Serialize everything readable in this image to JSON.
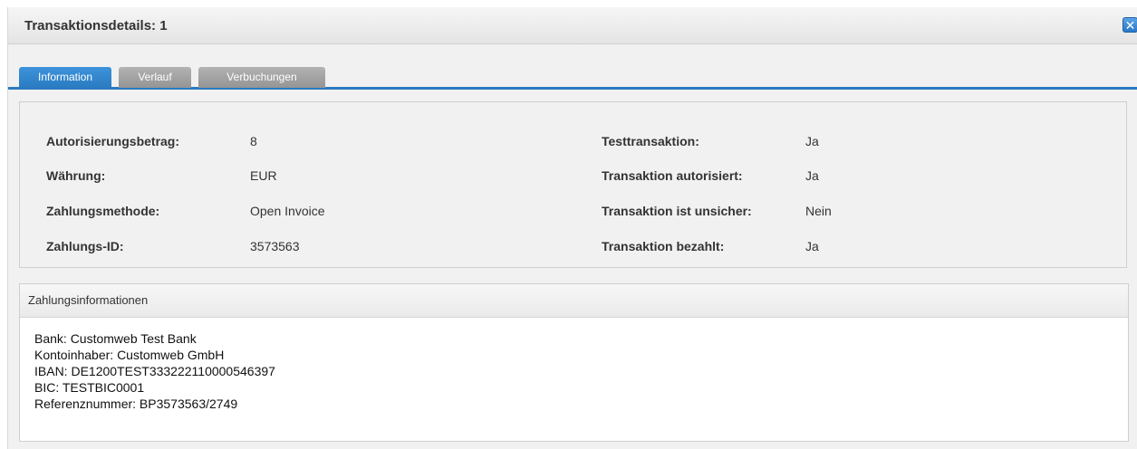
{
  "window": {
    "title": "Transaktionsdetails: 1",
    "close_symbol": "✕",
    "close_icon": "close-icon"
  },
  "tabs": [
    {
      "label": "Information",
      "active": true
    },
    {
      "label": "Verlauf",
      "active": false
    },
    {
      "label": "Verbuchungen",
      "active": false
    }
  ],
  "details": {
    "left": [
      {
        "label": "Autorisierungsbetrag:",
        "value": "8"
      },
      {
        "label": "Währung:",
        "value": "EUR"
      },
      {
        "label": "Zahlungsmethode:",
        "value": "Open Invoice"
      },
      {
        "label": "Zahlungs-ID:",
        "value": "3573563"
      }
    ],
    "right": [
      {
        "label": "Testtransaktion:",
        "value": "Ja"
      },
      {
        "label": "Transaktion autorisiert:",
        "value": "Ja"
      },
      {
        "label": "Transaktion ist unsicher:",
        "value": "Nein"
      },
      {
        "label": "Transaktion bezahlt:",
        "value": "Ja"
      }
    ]
  },
  "payment_info": {
    "header": "Zahlungsinformationen",
    "lines": [
      "Bank: Customweb Test Bank",
      "Kontoinhaber: Customweb GmbH",
      "IBAN: DE1200TEST333222110000546397",
      "BIC: TESTBIC0001",
      "Referenznummer: BP3573563/2749"
    ]
  },
  "colors": {
    "accent": "#2a7bc0",
    "inactive_tab": "#a3a3a3"
  }
}
